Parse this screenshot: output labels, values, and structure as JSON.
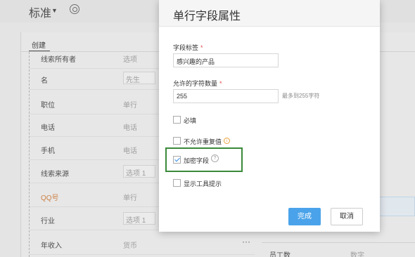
{
  "header": {
    "title": "标准",
    "caret": "▼",
    "settings_icon": "gear-icon"
  },
  "tabs": {
    "create": "创建"
  },
  "form_rows": [
    {
      "label": "线索所有者",
      "value": "选项",
      "type": "text"
    },
    {
      "label": "名",
      "value": "先生",
      "type": "select"
    },
    {
      "label": "职位",
      "value": "单行",
      "type": "text"
    },
    {
      "label": "电话",
      "value": "电话",
      "type": "text"
    },
    {
      "label": "手机",
      "value": "电话",
      "type": "text"
    },
    {
      "label": "线索来源",
      "value": "选项 1",
      "type": "select"
    },
    {
      "label": "QQ号",
      "value": "单行",
      "type": "text",
      "highlight": true
    },
    {
      "label": "行业",
      "value": "选项 1",
      "type": "select"
    },
    {
      "label": "年收入",
      "value": "货币",
      "type": "text",
      "menu": "···"
    }
  ],
  "right_panel": {
    "label": "员工数",
    "value": "数字"
  },
  "dialog": {
    "title": "单行字段属性",
    "field_label": {
      "label": "字段标签",
      "required_mark": "*",
      "value": "感兴趣的产品"
    },
    "max_chars": {
      "label": "允许的字符数量",
      "required_mark": "*",
      "value": "255",
      "hint": "最多到255字符"
    },
    "checkboxes": [
      {
        "label": "必填",
        "checked": false
      },
      {
        "label": "不允许重复值",
        "checked": false,
        "icon": "info-icon",
        "icon_glyph": "i"
      },
      {
        "label": "加密字段",
        "checked": true,
        "icon": "help-icon",
        "icon_glyph": "?"
      },
      {
        "label": "显示工具提示",
        "checked": false
      }
    ],
    "ok_label": "完成",
    "cancel_label": "取消"
  },
  "colors": {
    "primary": "#4aa3ea",
    "highlight_border": "#3a8a3a",
    "required": "#e34c4c"
  }
}
